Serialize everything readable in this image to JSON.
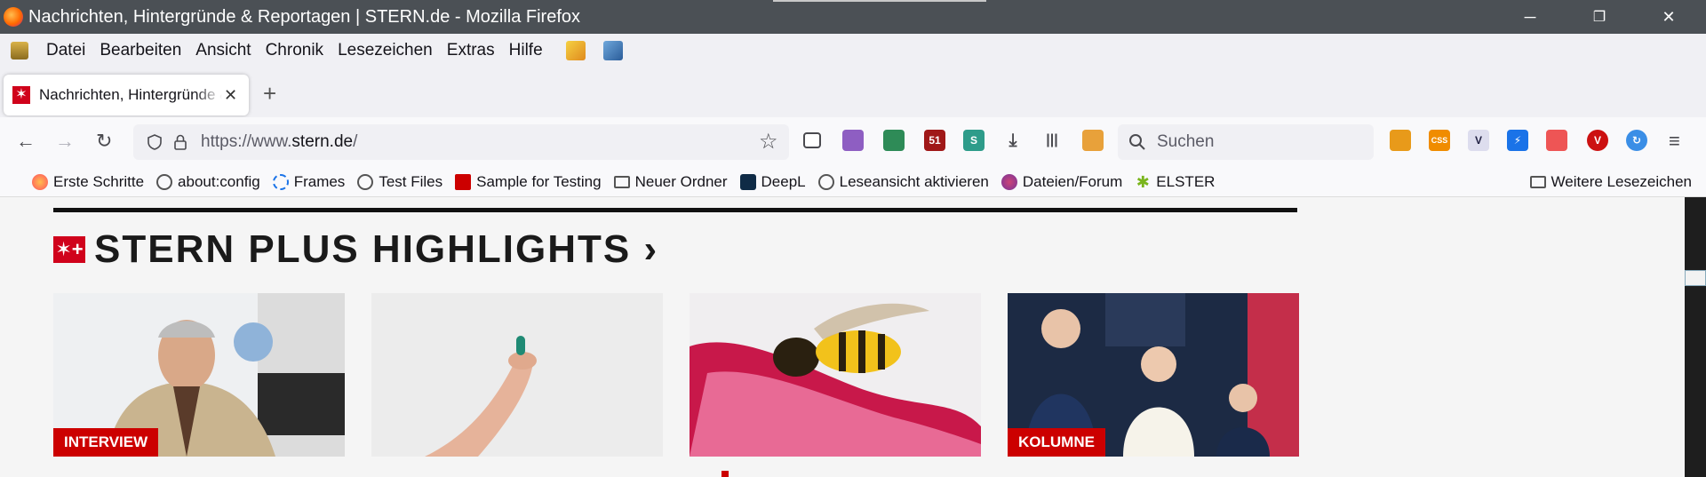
{
  "window": {
    "title": "Nachrichten, Hintergründe & Reportagen | STERN.de - Mozilla Firefox",
    "minimize": "─",
    "restore": "❐",
    "close": "✕"
  },
  "menubar": {
    "items": [
      "Datei",
      "Bearbeiten",
      "Ansicht",
      "Chronik",
      "Lesezeichen",
      "Extras",
      "Hilfe"
    ]
  },
  "tab": {
    "label": "Nachrichten, Hintergründe & Reportagen",
    "close": "✕",
    "new_tab": "+",
    "favicon": "✶"
  },
  "navbar": {
    "back": "←",
    "forward": "→",
    "reload": "↻",
    "url_prefix": "https://www.",
    "url_domain": "stern.de",
    "url_path": "/",
    "search_placeholder": "Suchen",
    "badge_count": "51",
    "star": "☆",
    "menu": "≡"
  },
  "bookmarks": {
    "items": [
      "Erste Schritte",
      "about:config",
      "Frames",
      "Test Files",
      "Sample for Testing",
      "Neuer Ordner",
      "DeepL",
      "Leseansicht aktivieren",
      "Dateien/Forum",
      "ELSTER"
    ],
    "more": "Weitere Lesezeichen"
  },
  "page": {
    "section_title": "STERN PLUS HIGHLIGHTS ›",
    "logo_text": "✶+",
    "cards": [
      {
        "badge": "INTERVIEW"
      },
      {
        "badge": ""
      },
      {
        "badge": ""
      },
      {
        "badge": "KOLUMNE"
      }
    ]
  }
}
